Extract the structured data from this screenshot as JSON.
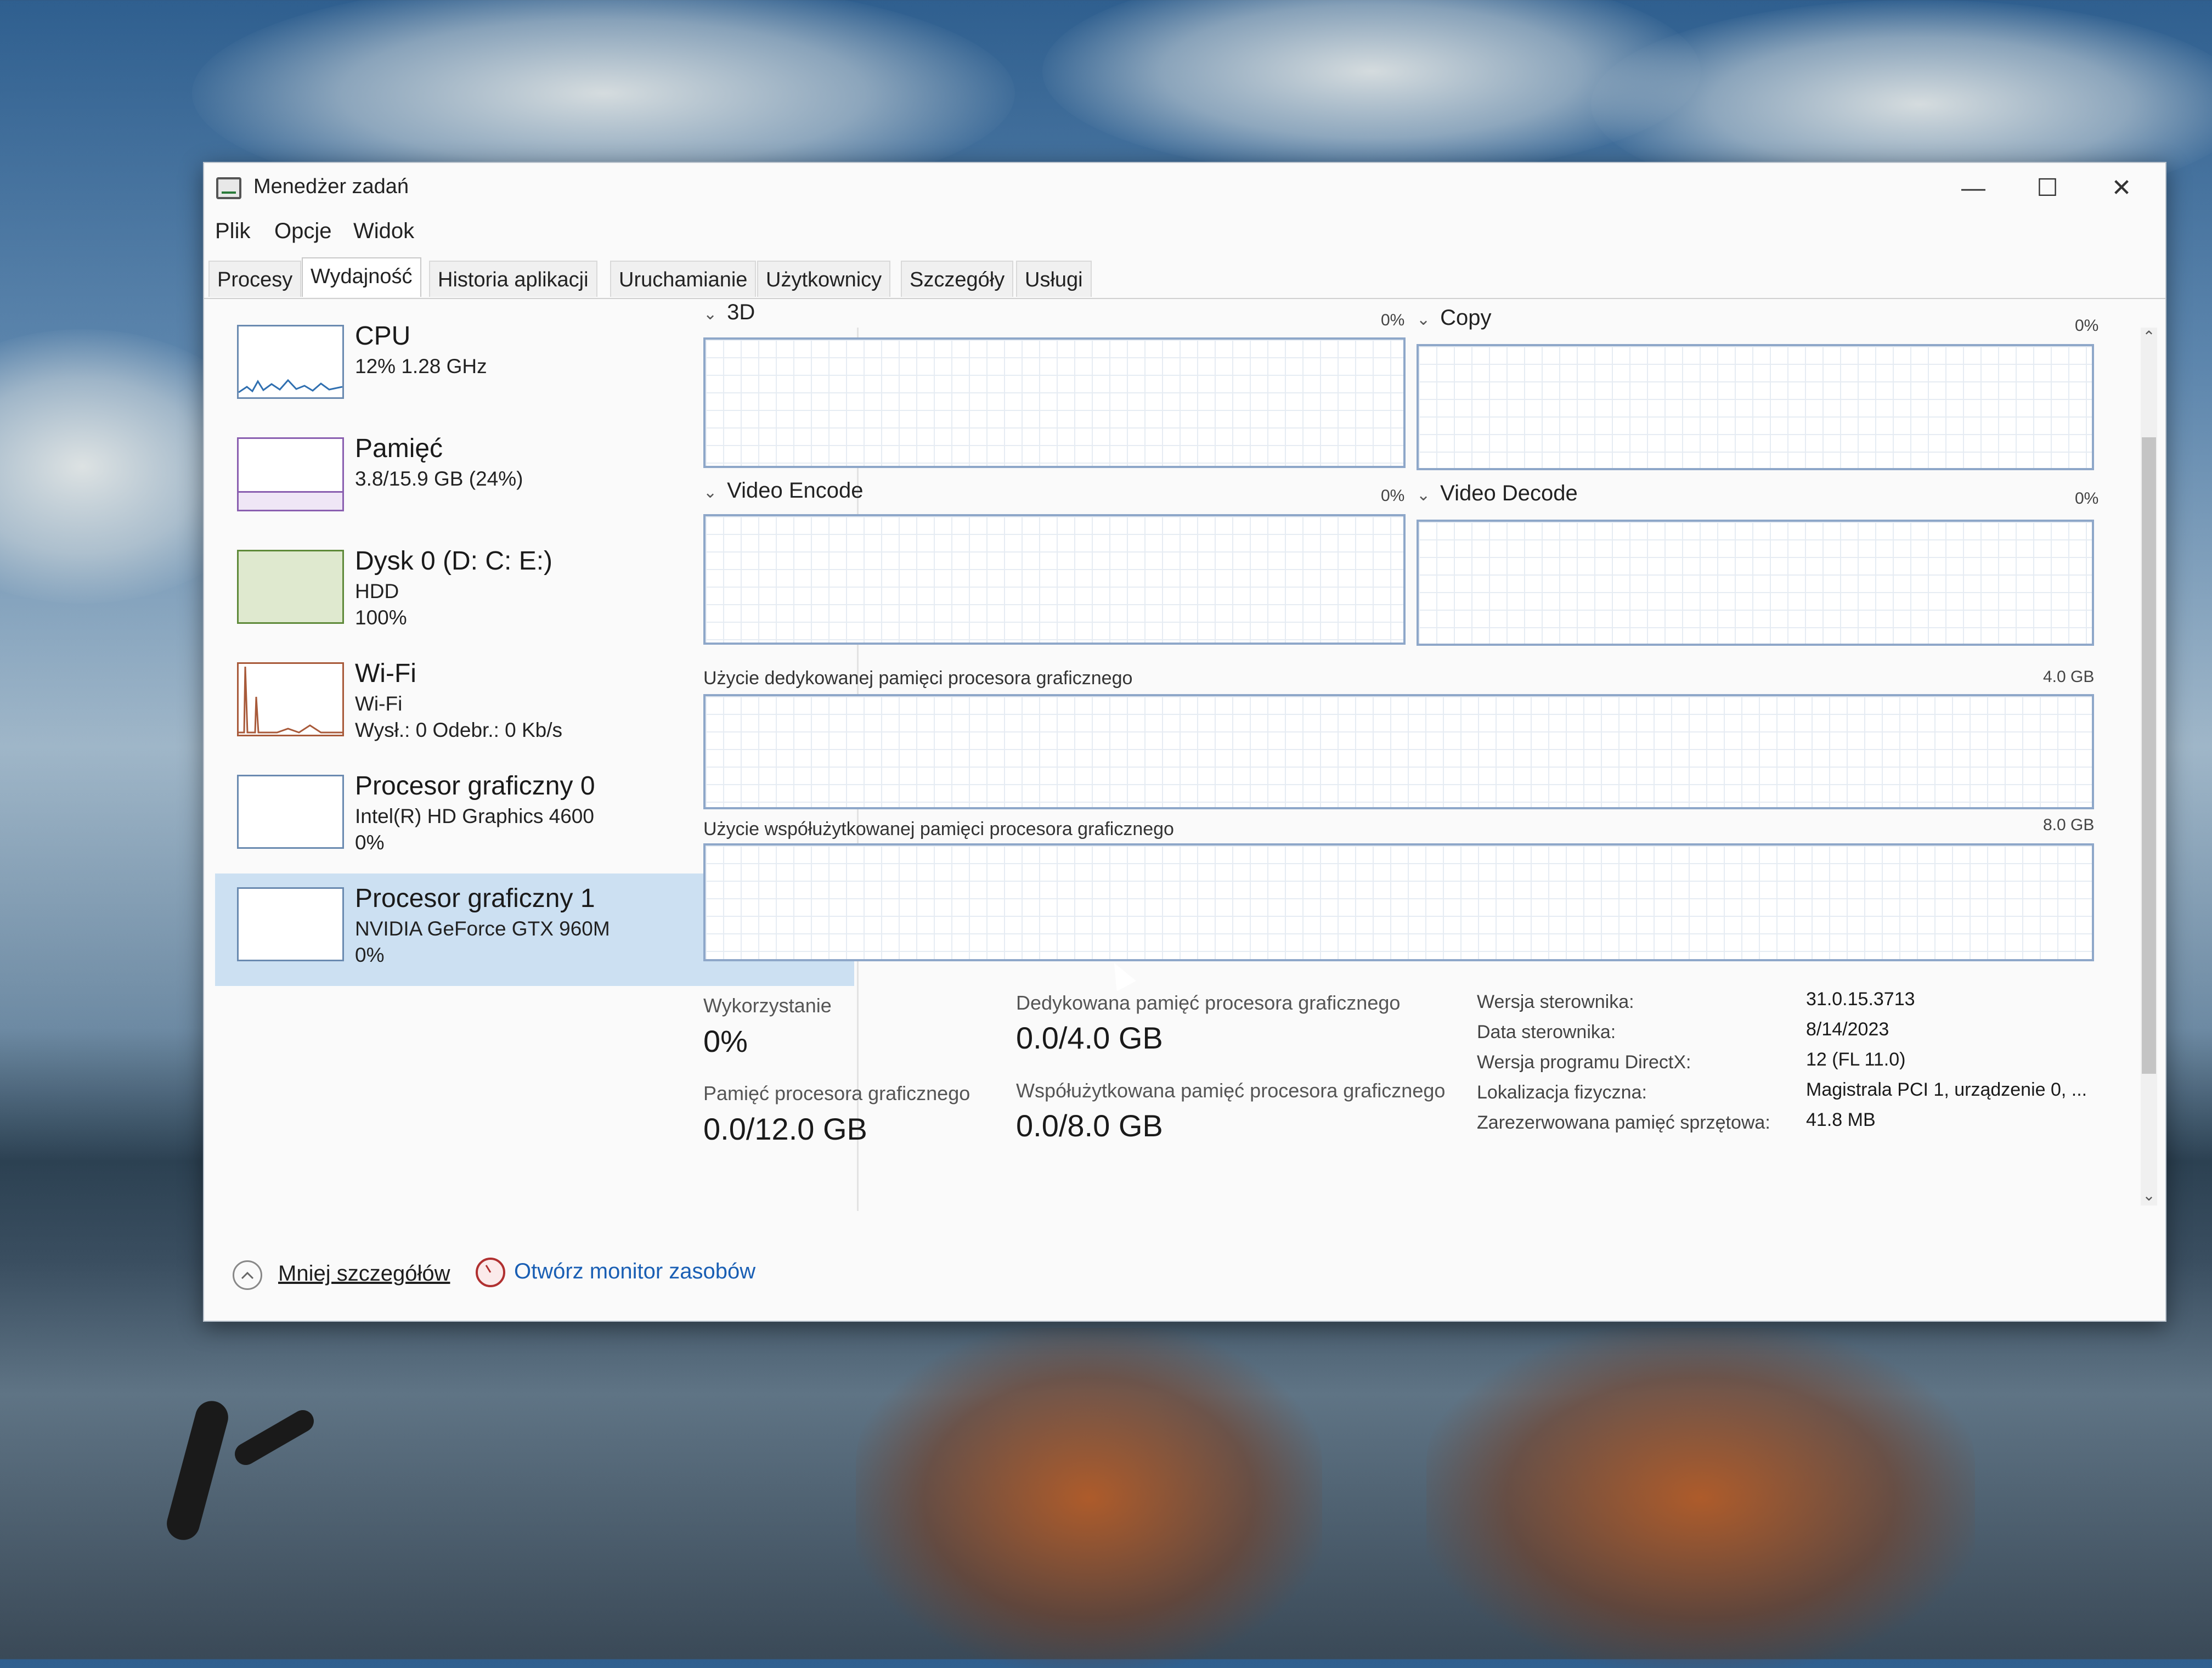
{
  "window": {
    "title": "Menedżer zadań",
    "buttons": {
      "minimize": "—",
      "maximize": "☐",
      "close": "✕"
    }
  },
  "menu": [
    "Plik",
    "Opcje",
    "Widok"
  ],
  "tabs": [
    "Procesy",
    "Wydajność",
    "Historia aplikacji",
    "Uruchamianie",
    "Użytkownicy",
    "Szczegóły",
    "Usługi"
  ],
  "active_tab": "Wydajność",
  "sidebar": [
    {
      "name": "CPU",
      "line1": "12%  1.28 GHz",
      "line2": "",
      "line3": ""
    },
    {
      "name": "Pamięć",
      "line1": "3.8/15.9 GB (24%)",
      "line2": "",
      "line3": ""
    },
    {
      "name": "Dysk 0 (D: C: E:)",
      "line1": "HDD",
      "line2": "100%",
      "line3": ""
    },
    {
      "name": "Wi-Fi",
      "line1": "Wi-Fi",
      "line2": "Wysł.: 0 Odebr.: 0 Kb/s",
      "line3": ""
    },
    {
      "name": "Procesor graficzny 0",
      "line1": "Intel(R) HD Graphics 4600",
      "line2": "0%",
      "line3": ""
    },
    {
      "name": "Procesor graficzny 1",
      "line1": "NVIDIA GeForce GTX 960M",
      "line2": "0%",
      "line3": ""
    }
  ],
  "engine_charts": [
    {
      "label": "3D",
      "percent": "0%"
    },
    {
      "label": "Copy",
      "percent": "0%"
    },
    {
      "label": "Video Encode",
      "percent": "0%"
    },
    {
      "label": "Video Decode",
      "percent": "0%"
    }
  ],
  "memory_charts": [
    {
      "label": "Użycie dedykowanej pamięci procesora graficznego",
      "max": "4.0 GB"
    },
    {
      "label": "Użycie współużytkowanej pamięci procesora graficznego",
      "max": "8.0 GB"
    }
  ],
  "stats": {
    "utilization_label": "Wykorzystanie",
    "utilization_value": "0%",
    "dedicated_label": "Dedykowana pamięć procesora graficznego",
    "dedicated_value": "0.0/4.0 GB",
    "gpu_memory_label": "Pamięć procesora graficznego",
    "gpu_memory_value": "0.0/12.0 GB",
    "shared_label": "Współużytkowana pamięć procesora graficznego",
    "shared_value": "0.0/8.0 GB"
  },
  "info": [
    {
      "key": "Wersja sterownika:",
      "value": "31.0.15.3713"
    },
    {
      "key": "Data sterownika:",
      "value": "8/14/2023"
    },
    {
      "key": "Wersja programu DirectX:",
      "value": "12 (FL 11.0)"
    },
    {
      "key": "Lokalizacja fizyczna:",
      "value": "Magistrala PCI 1, urządzenie 0, ..."
    },
    {
      "key": "Zarezerwowana pamięć sprzętowa:",
      "value": "41.8 MB"
    }
  ],
  "footer": {
    "less_details": "Mniej szczegółów",
    "resource_monitor": "Otwórz monitor zasobów"
  },
  "colors": {
    "selected_bg": "#cce0f2",
    "graph_border": "#8ea7c9",
    "link": "#1a5fb4"
  }
}
